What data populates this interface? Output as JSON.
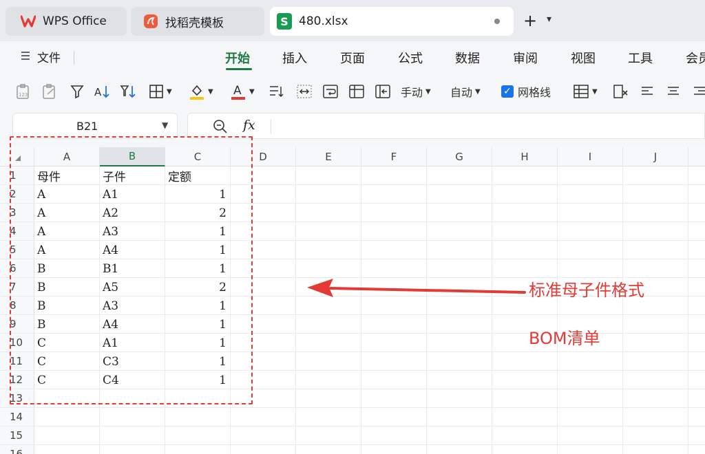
{
  "tabs": {
    "wps_office": "WPS Office",
    "daoke": "找稻壳模板",
    "file": "480.xlsx",
    "new_tab_symbol": "+",
    "new_tab_menu_symbol": "▾"
  },
  "menu": {
    "file_label": "文件",
    "tabs": [
      "开始",
      "插入",
      "页面",
      "公式",
      "数据",
      "审阅",
      "视图",
      "工具",
      "会员"
    ],
    "active_tab": "开始"
  },
  "toolbar": {
    "wrap_label": "手动",
    "auto_label": "自动",
    "gridlines_label": "网格线",
    "gridlines_checked": true,
    "fill_color": "#f5c518",
    "font_color": "#e53935"
  },
  "formula_bar": {
    "cell_ref": "B21",
    "fx_label": "fx",
    "formula": ""
  },
  "sheet": {
    "columns": [
      "A",
      "B",
      "C",
      "D",
      "E",
      "F",
      "G",
      "H",
      "I",
      "J"
    ],
    "selected_column": "B",
    "row_numbers": [
      "1",
      "2",
      "3",
      "4",
      "5",
      "6",
      "7",
      "8",
      "9",
      "10",
      "11",
      "12",
      "13",
      "14",
      "15",
      "16"
    ],
    "header": [
      "母件",
      "子件",
      "定额"
    ],
    "rows": [
      [
        "A",
        "A1",
        "1"
      ],
      [
        "A",
        "A2",
        "2"
      ],
      [
        "A",
        "A3",
        "1"
      ],
      [
        "A",
        "A4",
        "1"
      ],
      [
        "B",
        "B1",
        "1"
      ],
      [
        "B",
        "A5",
        "2"
      ],
      [
        "B",
        "A3",
        "1"
      ],
      [
        "B",
        "A4",
        "1"
      ],
      [
        "C",
        "A1",
        "1"
      ],
      [
        "C",
        "C3",
        "1"
      ],
      [
        "C",
        "C4",
        "1"
      ]
    ]
  },
  "annotations": {
    "label1": "标准母子件格式",
    "label2": "BOM清单",
    "color": "#e53935"
  },
  "colors": {
    "accent_green": "#1e7a43",
    "wps_red": "#e53935",
    "sheet_icon_green": "#1a9b53"
  }
}
